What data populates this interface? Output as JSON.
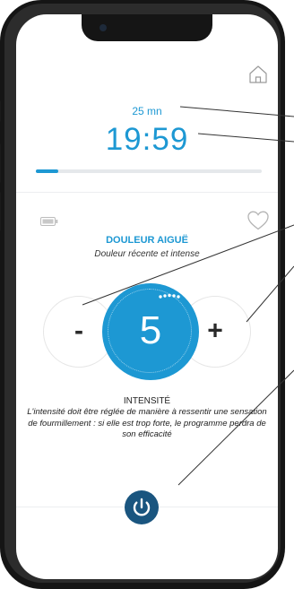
{
  "session": {
    "duration": "25 mn",
    "remaining": "19:59",
    "progress": 0.1
  },
  "program": {
    "title": "DOULEUR AIGUË",
    "subtitle": "Douleur récente et intense"
  },
  "controls": {
    "decrease_label": "-",
    "intensity_value": "5",
    "increase_label": "+"
  },
  "intensity": {
    "title": "INTENSITÉ",
    "description": "L'intensité doit être réglée de manière à ressentir une sensation de fourmillement : si elle est trop forte, le programme perdra de son efficacité"
  },
  "icons": {
    "home": "home-icon",
    "battery": "battery-icon",
    "favorite": "heart-icon",
    "power": "power-icon"
  },
  "colors": {
    "accent": "#1d98d3",
    "power_button": "#1a557f",
    "callout_line": "#333333"
  }
}
